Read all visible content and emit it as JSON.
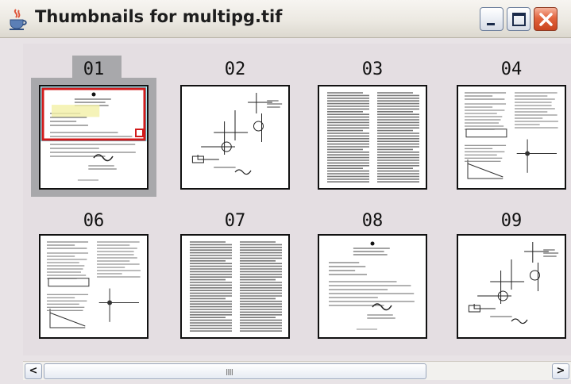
{
  "window": {
    "title": "Thumbnails for multipg.tif",
    "icon": "java-cup-icon",
    "controls": [
      "minimize-icon",
      "maximize-icon",
      "close-icon"
    ]
  },
  "thumbnails": [
    {
      "label": "01",
      "selected": true
    },
    {
      "label": "02",
      "selected": false
    },
    {
      "label": "03",
      "selected": false
    },
    {
      "label": "04",
      "selected": false
    },
    {
      "label": "06",
      "selected": false
    },
    {
      "label": "07",
      "selected": false
    },
    {
      "label": "08",
      "selected": false
    },
    {
      "label": "09",
      "selected": false
    }
  ],
  "scrollbar": {
    "left_arrow": "<",
    "right_arrow": ">",
    "grip": "IIII"
  },
  "colors": {
    "selection_highlight": "#a8a8ab",
    "viewport_box": "#d11b1b",
    "page_border": "#111111",
    "close_button": "#d9532c"
  }
}
